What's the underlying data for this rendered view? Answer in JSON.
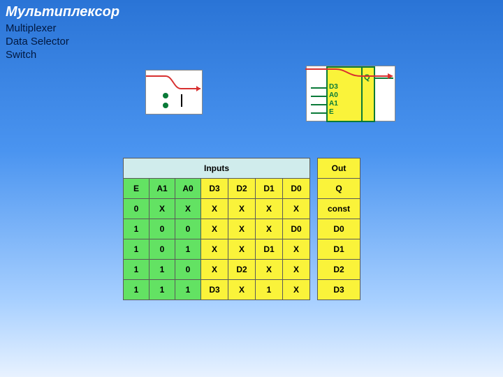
{
  "title": "Мультиплексор",
  "subtitle_lines": [
    "Multiplexer",
    "Data Selector",
    "Switch"
  ],
  "mux_block": {
    "pins": [
      "D3",
      "A0",
      "A1",
      "E"
    ],
    "out": "Q"
  },
  "table": {
    "header_inputs": "Inputs",
    "header_out": "Out",
    "cols_green": [
      "E",
      "A1",
      "A0"
    ],
    "cols_yellow": [
      "D3",
      "D2",
      "D1",
      "D0"
    ],
    "col_out": "Q",
    "rows": [
      {
        "g": [
          "0",
          "X",
          "X"
        ],
        "y": [
          "X",
          "X",
          "X",
          "X"
        ],
        "o": "const"
      },
      {
        "g": [
          "1",
          "0",
          "0"
        ],
        "y": [
          "X",
          "X",
          "X",
          "D0"
        ],
        "o": "D0"
      },
      {
        "g": [
          "1",
          "0",
          "1"
        ],
        "y": [
          "X",
          "X",
          "D1",
          "X"
        ],
        "o": "D1"
      },
      {
        "g": [
          "1",
          "1",
          "0"
        ],
        "y": [
          "X",
          "D2",
          "X",
          "X"
        ],
        "o": "D2"
      },
      {
        "g": [
          "1",
          "1",
          "1"
        ],
        "y": [
          "D3",
          "X",
          "1",
          "X"
        ],
        "o": "D3"
      }
    ]
  },
  "chart_data": {
    "type": "table",
    "title": "Multiplexer truth table",
    "columns": [
      "E",
      "A1",
      "A0",
      "D3",
      "D2",
      "D1",
      "D0",
      "Q"
    ],
    "rows": [
      [
        "0",
        "X",
        "X",
        "X",
        "X",
        "X",
        "X",
        "const"
      ],
      [
        "1",
        "0",
        "0",
        "X",
        "X",
        "X",
        "D0",
        "D0"
      ],
      [
        "1",
        "0",
        "1",
        "X",
        "X",
        "D1",
        "X",
        "D1"
      ],
      [
        "1",
        "1",
        "0",
        "X",
        "D2",
        "X",
        "X",
        "D2"
      ],
      [
        "1",
        "1",
        "1",
        "D3",
        "X",
        "1",
        "X",
        "D3"
      ]
    ]
  }
}
